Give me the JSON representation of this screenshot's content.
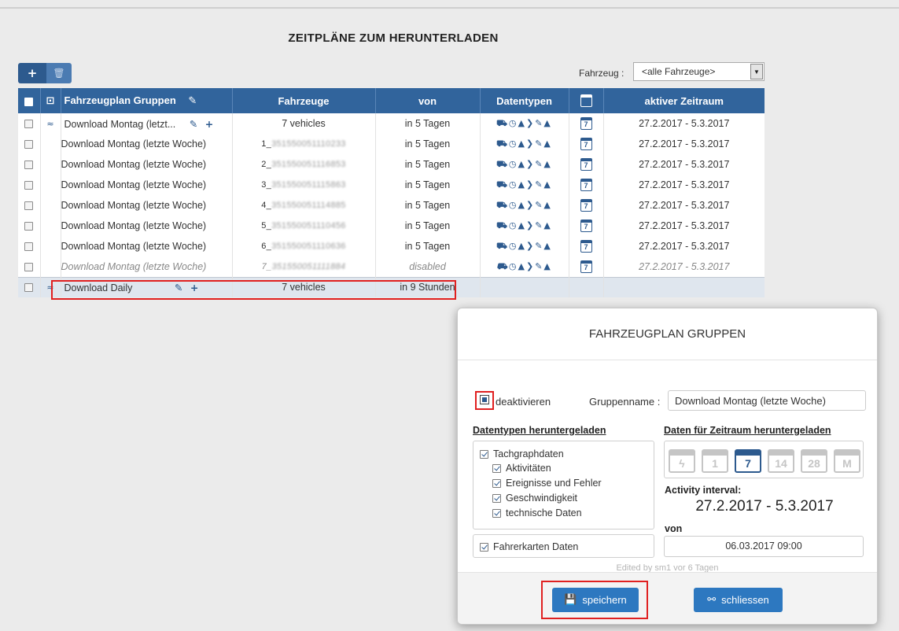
{
  "page": {
    "title": "ZEITPLÄNE ZUM HERUNTERLADEN"
  },
  "toolbar": {
    "add_icon": "+",
    "delete_icon": "🗑"
  },
  "filter": {
    "label": "Fahrzeug :",
    "selected": "<alle Fahrzeuge>"
  },
  "table": {
    "headers": {
      "group": "Fahrzeugplan Gruppen",
      "vehicles": "Fahrzeuge",
      "from": "von",
      "datatypes": "Datentypen",
      "calendar_num": "",
      "period": "aktiver Zeitraum"
    },
    "group_row": {
      "name": "Download Montag (letzt...",
      "vehicles": "7 vehicles",
      "from": "in 5 Tagen",
      "calendar": "7",
      "period": "27.2.2017 - 5.3.2017"
    },
    "rows": [
      {
        "name": "Download Montag (letzte Woche)",
        "vehicle_prefix": "1_",
        "vehicle_id": "351550051110233",
        "from": "in 5 Tagen",
        "calendar": "7",
        "period": "27.2.2017 - 5.3.2017"
      },
      {
        "name": "Download Montag (letzte Woche)",
        "vehicle_prefix": "2_",
        "vehicle_id": "351550051116853",
        "from": "in 5 Tagen",
        "calendar": "7",
        "period": "27.2.2017 - 5.3.2017"
      },
      {
        "name": "Download Montag (letzte Woche)",
        "vehicle_prefix": "3_",
        "vehicle_id": "351550051115863",
        "from": "in 5 Tagen",
        "calendar": "7",
        "period": "27.2.2017 - 5.3.2017"
      },
      {
        "name": "Download Montag (letzte Woche)",
        "vehicle_prefix": "4_",
        "vehicle_id": "351550051114885",
        "from": "in 5 Tagen",
        "calendar": "7",
        "period": "27.2.2017 - 5.3.2017"
      },
      {
        "name": "Download Montag (letzte Woche)",
        "vehicle_prefix": "5_",
        "vehicle_id": "351550051110456",
        "from": "in 5 Tagen",
        "calendar": "7",
        "period": "27.2.2017 - 5.3.2017"
      },
      {
        "name": "Download Montag (letzte Woche)",
        "vehicle_prefix": "6_",
        "vehicle_id": "351550051110636",
        "from": "in 5 Tagen",
        "calendar": "7",
        "period": "27.2.2017 - 5.3.2017"
      },
      {
        "name": "Download Montag (letzte Woche)",
        "vehicle_prefix": "7_",
        "vehicle_id": "351550051111884",
        "from": "disabled",
        "calendar": "7",
        "period": "27.2.2017 - 5.3.2017"
      }
    ],
    "footer_row": {
      "name": "Download Daily",
      "vehicles": "7 vehicles",
      "from": "in 9 Stunden"
    },
    "datatype_icons": "⛟◷▲❯✎▲"
  },
  "modal": {
    "title": "FAHRZEUGPLAN GRUPPEN",
    "deactivate_label": "deaktivieren",
    "group_name_label": "Gruppenname :",
    "group_name_value": "Download Montag (letzte Woche)",
    "datatypes_title": "Datentypen heruntergeladen",
    "datatypes": {
      "tacho": "Tachgraphdaten",
      "activities": "Aktivitäten",
      "events": "Ereignisse und Fehler",
      "speed": "Geschwindigkeit",
      "technical": "technische Daten",
      "driver_cards": "Fahrerkarten Daten"
    },
    "range_title": "Daten für Zeitraum heruntergeladen",
    "range_options": [
      "ϟ",
      "1",
      "7",
      "14",
      "28",
      "M"
    ],
    "activity_label": "Activity interval:",
    "activity_value": "27.2.2017 - 5.3.2017",
    "from_label": "von",
    "from_value": "06.03.2017 09:00",
    "edited_by": "Edited by   sm1 vor 6 Tagen",
    "save_label": "speichern",
    "close_label": "schliessen"
  }
}
